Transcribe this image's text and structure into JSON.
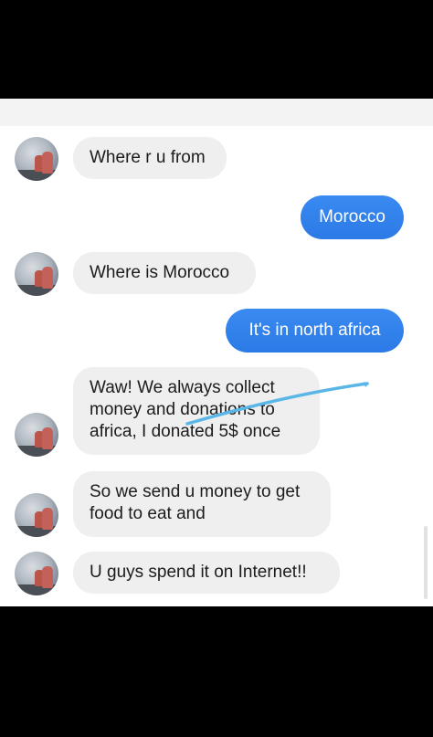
{
  "conversation": {
    "messages": [
      {
        "sender": "them",
        "text": "Where r u from"
      },
      {
        "sender": "me",
        "text": "Morocco"
      },
      {
        "sender": "them",
        "text": "Where is Morocco"
      },
      {
        "sender": "me",
        "text": "It's in north africa"
      },
      {
        "sender": "them",
        "lines": [
          "Waw! We always collect",
          "money and donations to",
          "africa, I donated 5$  once"
        ]
      },
      {
        "sender": "them",
        "lines": [
          "So we send u money to get",
          "food to eat and"
        ]
      },
      {
        "sender": "them",
        "text": "U guys spend it on Internet!!"
      }
    ]
  },
  "colors": {
    "outgoing_bubble": "#2f80ed",
    "incoming_bubble": "#efefef",
    "scribble": "#59b6e6"
  }
}
